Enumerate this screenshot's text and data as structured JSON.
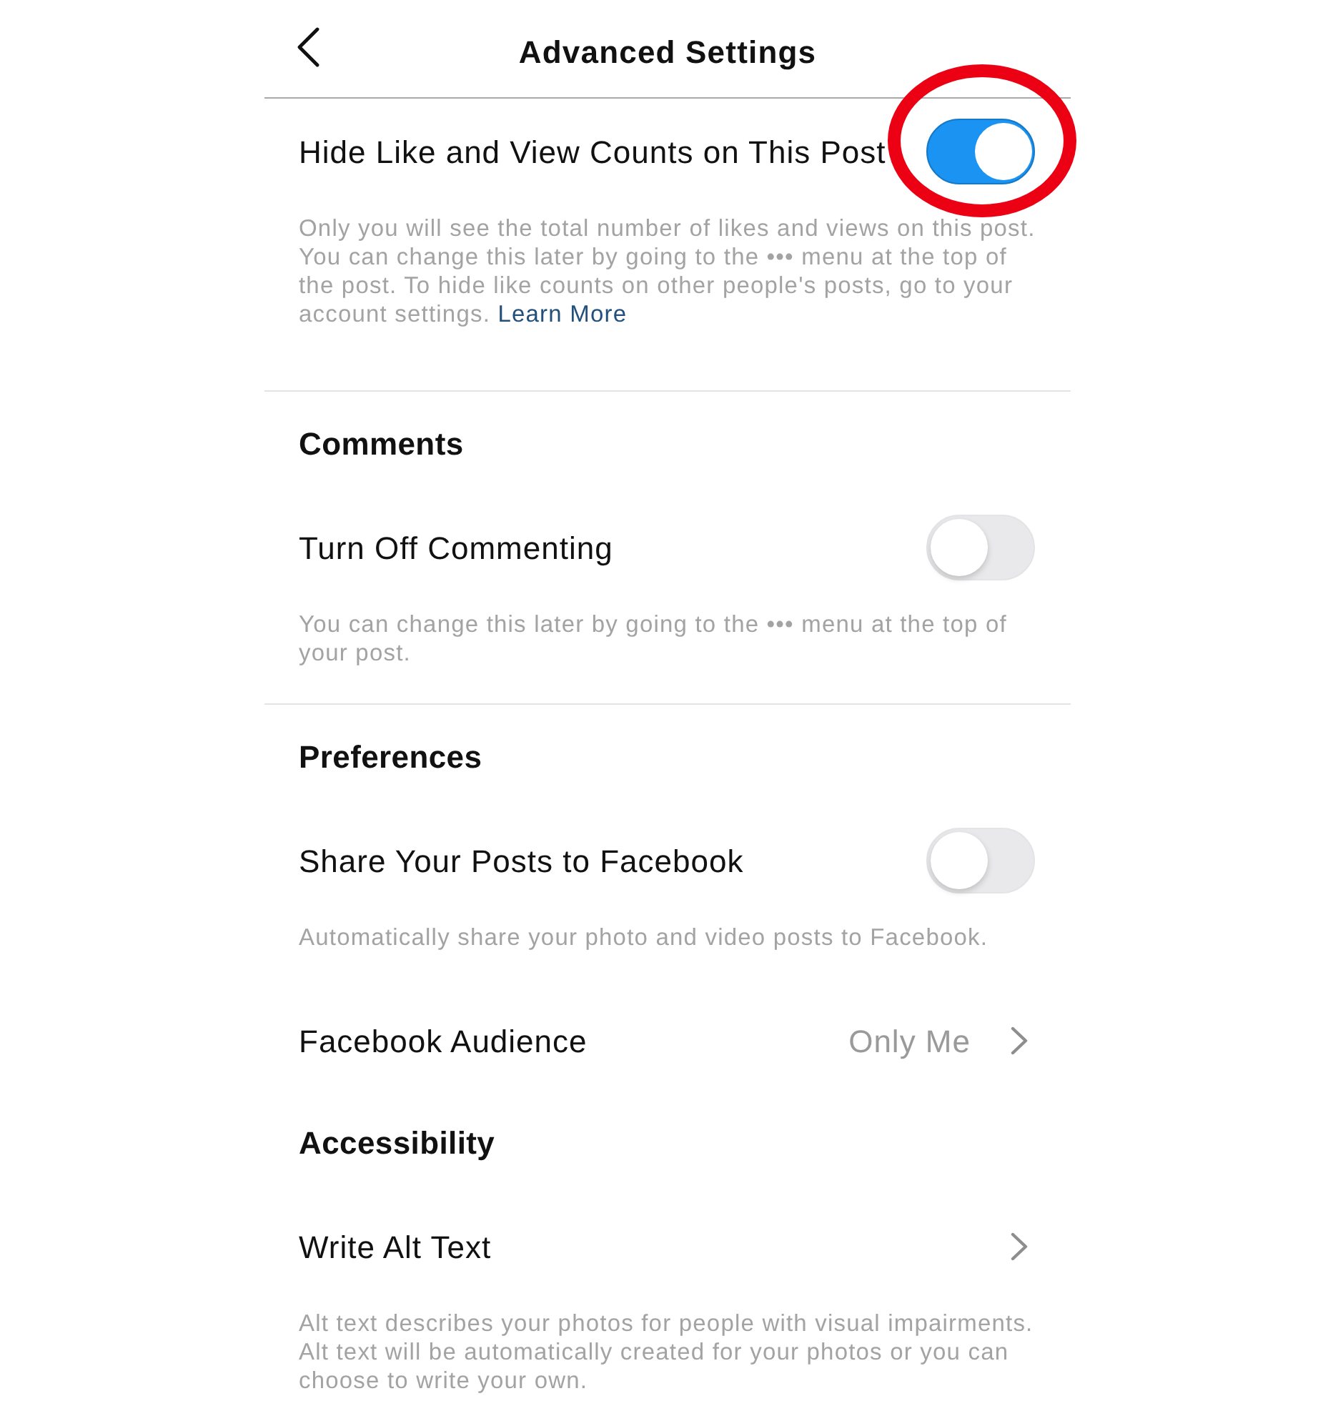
{
  "header": {
    "title": "Advanced Settings"
  },
  "sections": [
    {
      "divider": false,
      "rows": [
        {
          "kind": "toggle",
          "label": "Hide Like and View Counts on This Post",
          "on": true,
          "highlighted": true,
          "description": "Only you will see the total number of likes and views on this post. You can change this later by going to the ••• menu at the top of the post. To hide like counts on other people's posts, go to your account settings.",
          "link": "Learn More"
        }
      ]
    },
    {
      "divider": true,
      "heading": "Comments",
      "rows": [
        {
          "kind": "toggle",
          "label": "Turn Off Commenting",
          "on": false,
          "highlighted": false,
          "description": "You can change this later by going to the ••• menu at the top of your post."
        }
      ]
    },
    {
      "divider": true,
      "heading": "Preferences",
      "rows": [
        {
          "kind": "toggle",
          "label": "Share Your Posts to Facebook",
          "on": false,
          "highlighted": false,
          "description": "Automatically share your photo and video posts to Facebook."
        },
        {
          "kind": "link",
          "label": "Facebook Audience",
          "value": "Only Me"
        }
      ]
    },
    {
      "divider": false,
      "heading": "Accessibility",
      "rows": [
        {
          "kind": "link",
          "label": "Write Alt Text",
          "description": "Alt text describes your photos for people with visual impairments. Alt text will be automatically created for your photos or you can choose to write your own."
        }
      ]
    }
  ]
}
